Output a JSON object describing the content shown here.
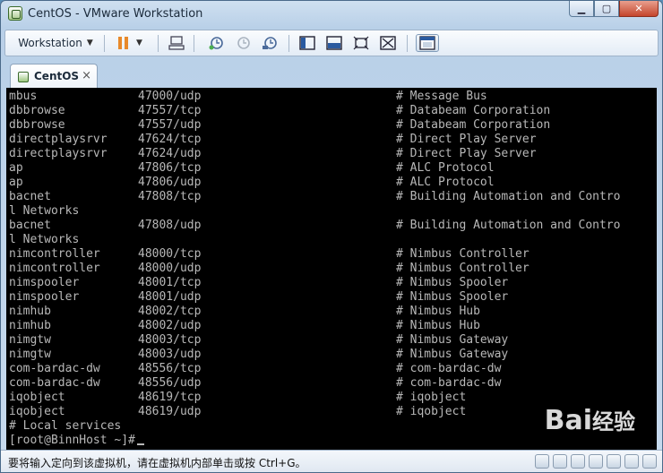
{
  "window": {
    "title": "CentOS - VMware Workstation",
    "controls": {
      "minimize": "▁",
      "maximize": "▢",
      "close": "✕"
    }
  },
  "toolbar": {
    "workstation_menu": "Workstation",
    "icons": [
      "pause-icon",
      "send-keys-icon",
      "snapshot-icon",
      "revert-snapshot-icon",
      "snapshot-manager-icon",
      "console-view-icon",
      "quick-switch-icon",
      "fullscreen-icon",
      "unity-icon",
      "library-icon"
    ]
  },
  "tab": {
    "label": "CentOS",
    "close": "×"
  },
  "console": {
    "lines": [
      [
        "mbus",
        "47000/udp",
        "# Message Bus"
      ],
      [
        "dbbrowse",
        "47557/tcp",
        "# Databeam Corporation"
      ],
      [
        "dbbrowse",
        "47557/udp",
        "# Databeam Corporation"
      ],
      [
        "directplaysrvr",
        "47624/tcp",
        "# Direct Play Server"
      ],
      [
        "directplaysrvr",
        "47624/udp",
        "# Direct Play Server"
      ],
      [
        "ap",
        "47806/tcp",
        "# ALC Protocol"
      ],
      [
        "ap",
        "47806/udp",
        "# ALC Protocol"
      ],
      [
        "bacnet",
        "47808/tcp",
        "# Building Automation and Contro"
      ],
      [
        "l Networks",
        "",
        ""
      ],
      [
        "bacnet",
        "47808/udp",
        "# Building Automation and Contro"
      ],
      [
        "l Networks",
        "",
        ""
      ],
      [
        "nimcontroller",
        "48000/tcp",
        "# Nimbus Controller"
      ],
      [
        "nimcontroller",
        "48000/udp",
        "# Nimbus Controller"
      ],
      [
        "nimspooler",
        "48001/tcp",
        "# Nimbus Spooler"
      ],
      [
        "nimspooler",
        "48001/udp",
        "# Nimbus Spooler"
      ],
      [
        "nimhub",
        "48002/tcp",
        "# Nimbus Hub"
      ],
      [
        "nimhub",
        "48002/udp",
        "# Nimbus Hub"
      ],
      [
        "nimgtw",
        "48003/tcp",
        "# Nimbus Gateway"
      ],
      [
        "nimgtw",
        "48003/udp",
        "# Nimbus Gateway"
      ],
      [
        "com-bardac-dw",
        "48556/tcp",
        "# com-bardac-dw"
      ],
      [
        "com-bardac-dw",
        "48556/udp",
        "# com-bardac-dw"
      ],
      [
        "iqobject",
        "48619/tcp",
        "# iqobject"
      ],
      [
        "iqobject",
        "48619/udp",
        "# iqobject"
      ],
      [
        "# Local services",
        "",
        ""
      ]
    ],
    "prompt": "[root@BinnHost ~]#"
  },
  "status": {
    "text": "要将输入定向到该虚拟机，请在虚拟机内部单击或按 Ctrl+G。"
  },
  "watermark": {
    "text": "Bai",
    "suffix": "经验"
  }
}
